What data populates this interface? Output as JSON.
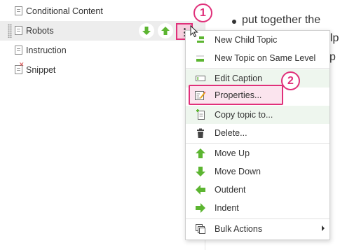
{
  "tree": {
    "items": [
      {
        "label": "Conditional Content",
        "icon": "document-icon"
      },
      {
        "label": "Robots",
        "icon": "document-icon",
        "selected": true
      },
      {
        "label": "Instruction",
        "icon": "document-icon"
      },
      {
        "label": "Snippet",
        "icon": "snippet-icon"
      }
    ],
    "row_actions": [
      "move-down-icon",
      "move-up-icon",
      "more-options-icon"
    ]
  },
  "document": {
    "bullet_text": "put together the",
    "fragments": [
      "elp",
      "l p"
    ]
  },
  "context_menu": {
    "items": [
      {
        "label": "New Child Topic",
        "icon": "new-child-topic-icon"
      },
      {
        "label": "New Topic on Same Level",
        "icon": "new-sibling-topic-icon"
      },
      {
        "label": "Edit Caption",
        "icon": "edit-caption-icon"
      },
      {
        "label": "Properties...",
        "icon": "properties-icon"
      },
      {
        "label": "Copy topic to...",
        "icon": "copy-topic-icon"
      },
      {
        "label": "Delete...",
        "icon": "trash-icon"
      },
      {
        "label": "Move Up",
        "icon": "arrow-up-icon"
      },
      {
        "label": "Move Down",
        "icon": "arrow-down-icon"
      },
      {
        "label": "Outdent",
        "icon": "arrow-left-icon"
      },
      {
        "label": "Indent",
        "icon": "arrow-right-icon"
      },
      {
        "label": "Bulk Actions",
        "icon": "bulk-actions-icon",
        "has_submenu": true
      }
    ]
  },
  "callouts": [
    "1",
    "2"
  ],
  "colors": {
    "accent_pink": "#e0307a",
    "action_green": "#5cb531",
    "menu_hover_green": "#eef6ee"
  }
}
